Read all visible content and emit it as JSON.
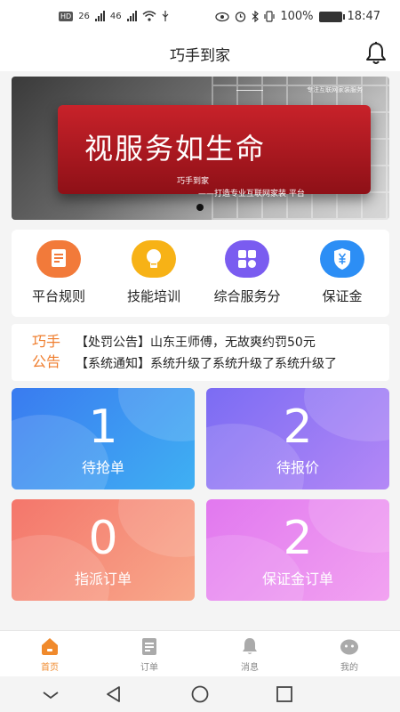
{
  "status_bar": {
    "hd": "HD",
    "net1": "26",
    "net2": "46",
    "battery": "100%",
    "time": "18:47"
  },
  "header": {
    "title": "巧手到家",
    "bell_icon": "bell-icon"
  },
  "banner": {
    "top_tag": "专注互联网家装服务",
    "headline": "视服务如生命",
    "brand": "巧手到家",
    "slogan": "——打造专业互联网家装 平台"
  },
  "quick_menu": [
    {
      "label": "平台规则",
      "icon": "clipboard-icon",
      "color": "#f27a3a"
    },
    {
      "label": "技能培训",
      "icon": "lightbulb-icon",
      "color": "#f7b216"
    },
    {
      "label": "综合服务分",
      "icon": "grid-icon",
      "color": "#7a5cf0"
    },
    {
      "label": "保证金",
      "icon": "shield-yen-icon",
      "color": "#2c8ef5"
    }
  ],
  "notice": {
    "title": "巧手公告",
    "items": [
      "【处罚公告】山东王师傅，无故爽约罚50元",
      "【系统通知】系统升级了系统升级了系统升级了"
    ]
  },
  "cards": [
    {
      "count": "1",
      "label": "待抢单",
      "gradient": [
        "#3a7bf0",
        "#3fb0f3"
      ]
    },
    {
      "count": "2",
      "label": "待报价",
      "gradient": [
        "#7b6cf3",
        "#b488f6"
      ]
    },
    {
      "count": "0",
      "label": "指派订单",
      "gradient": [
        "#f4766b",
        "#f8a98b"
      ]
    },
    {
      "count": "2",
      "label": "保证金订单",
      "gradient": [
        "#e178ef",
        "#f2a3f1"
      ]
    }
  ],
  "tabbar": {
    "active_color": "#f08a2c",
    "items": [
      {
        "label": "首页",
        "icon": "home-icon"
      },
      {
        "label": "订单",
        "icon": "order-icon"
      },
      {
        "label": "消息",
        "icon": "bell-icon"
      },
      {
        "label": "我的",
        "icon": "profile-icon"
      }
    ]
  }
}
